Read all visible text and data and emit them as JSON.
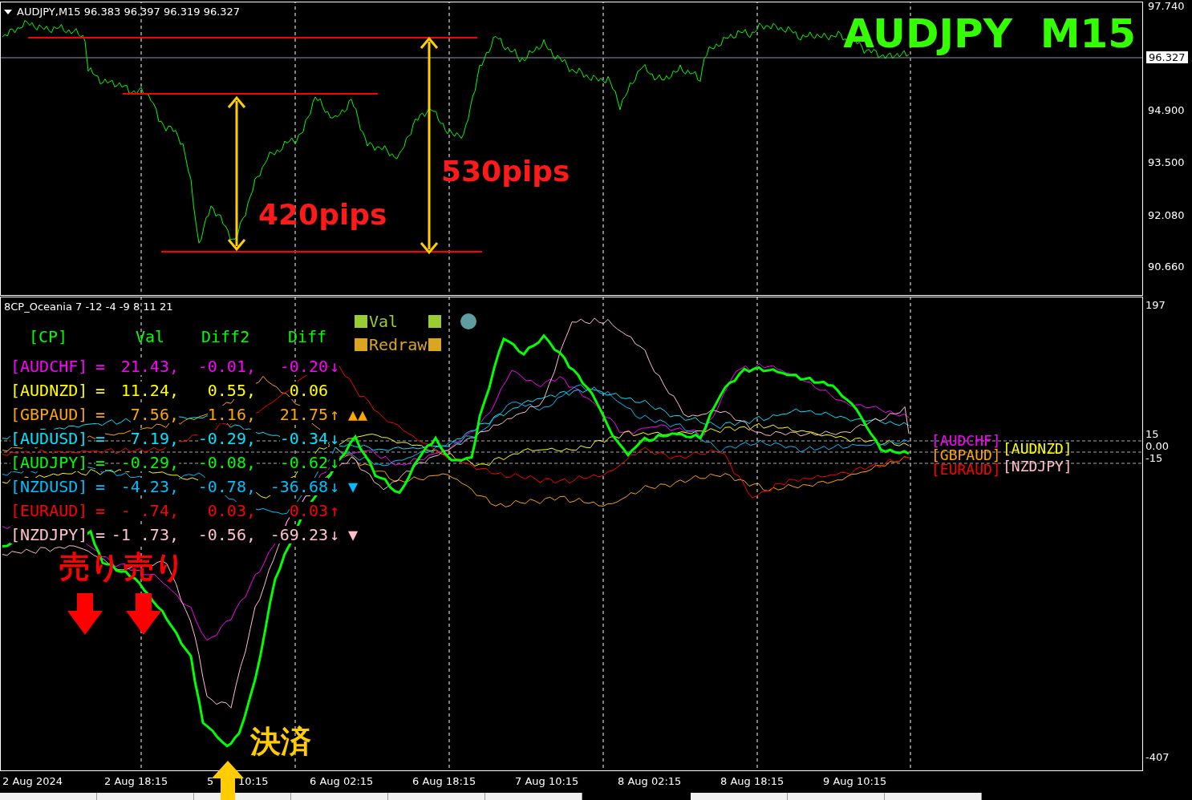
{
  "chart": {
    "header": "AUDJPY,M15  96.383 96.397 96.319 96.327",
    "title": "AUDJPY  M15",
    "price_axis": [
      "97.740",
      "94.900",
      "93.500",
      "92.080",
      "90.660"
    ],
    "current_price": "96.327",
    "annotations": [
      {
        "kind": "measure",
        "text": "420pips"
      },
      {
        "kind": "measure",
        "text": "530pips"
      }
    ]
  },
  "indicator": {
    "header": "8CP_Oceania 7 -12 -4 -9 8 11 21",
    "columns": [
      "[CP]",
      "Val",
      "Diff2",
      "Diff"
    ],
    "legend": [
      {
        "text": "Val"
      },
      {
        "text": "Redraw"
      }
    ],
    "rows": [
      {
        "pair": "[AUDCHF]",
        "eq": "=",
        "val": "21.43,",
        "diff2": "-0.01,",
        "diff": "-0.20",
        "trend": "↓",
        "marker": "",
        "color": "#ff00ff"
      },
      {
        "pair": "[AUDNZD]",
        "eq": "=",
        "val": "11.24,",
        "diff2": "0.55,",
        "diff": "0.06",
        "trend": "",
        "marker": "",
        "color": "#ffff00"
      },
      {
        "pair": "[GBPAUD]",
        "eq": "=",
        "val": "7.56,",
        "diff2": "1.16,",
        "diff": "21.75",
        "trend": "↑",
        "marker": "▲▲",
        "color": "#ffa500"
      },
      {
        "pair": "[AUDUSD]",
        "eq": "=",
        "val": "7.19,",
        "diff2": "-0.29,",
        "diff": "-0.34",
        "trend": "↓",
        "marker": "",
        "color": "#00e5ff"
      },
      {
        "pair": "[AUDJPY]",
        "eq": "=",
        "val": "-0.29,",
        "diff2": "-0.08,",
        "diff": "-0.62",
        "trend": "↓",
        "marker": "",
        "color": "#00ff00"
      },
      {
        "pair": "[NZDUSD]",
        "eq": "=",
        "val": "-4.23,",
        "diff2": "-0.78,",
        "diff": "-36.68",
        "trend": "↓",
        "marker": "▼",
        "color": "#00bfff"
      },
      {
        "pair": "[EURAUD]",
        "eq": "=",
        "val": "- .74,",
        "diff2": "0.03,",
        "diff": "0.03",
        "trend": "↑",
        "marker": "",
        "color": "#ff0000"
      },
      {
        "pair": "[NZDJPY]",
        "eq": "=",
        "val": "-1 .73,",
        "diff2": "-0.56,",
        "diff": "-69.23",
        "trend": "↓",
        "marker": "▼",
        "color": "#ffc0cb"
      }
    ],
    "lines": [
      {
        "kind": "thin"
      },
      {
        "kind": "thin"
      },
      {
        "kind": "thin"
      },
      {
        "kind": "thin"
      },
      {
        "kind": "thick"
      },
      {
        "kind": "thin"
      },
      {
        "kind": "thin"
      },
      {
        "kind": "thin"
      }
    ],
    "end_labels": [
      {
        "text": "[AUDCHF]",
        "color": "#ff00ff"
      },
      {
        "text": "[GBPAUD]",
        "color": "#ffa500"
      },
      {
        "text": "[EURAUD]",
        "color": "#ff0000"
      },
      {
        "text": "[AUDNZD]",
        "color": "#ffff00"
      },
      {
        "text": "[NZDJPY]",
        "color": "#ffc0cb"
      }
    ],
    "axis": [
      "197",
      "15",
      "0.00",
      "-15",
      "-407"
    ],
    "signals": [
      {
        "kind": "sell",
        "text": "売り"
      },
      {
        "kind": "sell",
        "text": "売り"
      },
      {
        "kind": "close",
        "text": "決済"
      }
    ]
  },
  "time_axis": [
    "2 Aug 2024",
    "2 Aug 18:15",
    "5",
    "10:15",
    "6 Aug 02:15",
    "6 Aug 18:15",
    "7 Aug 10:15",
    "8 Aug 02:15",
    "8 Aug 18:15",
    "9 Aug 10:15"
  ]
}
